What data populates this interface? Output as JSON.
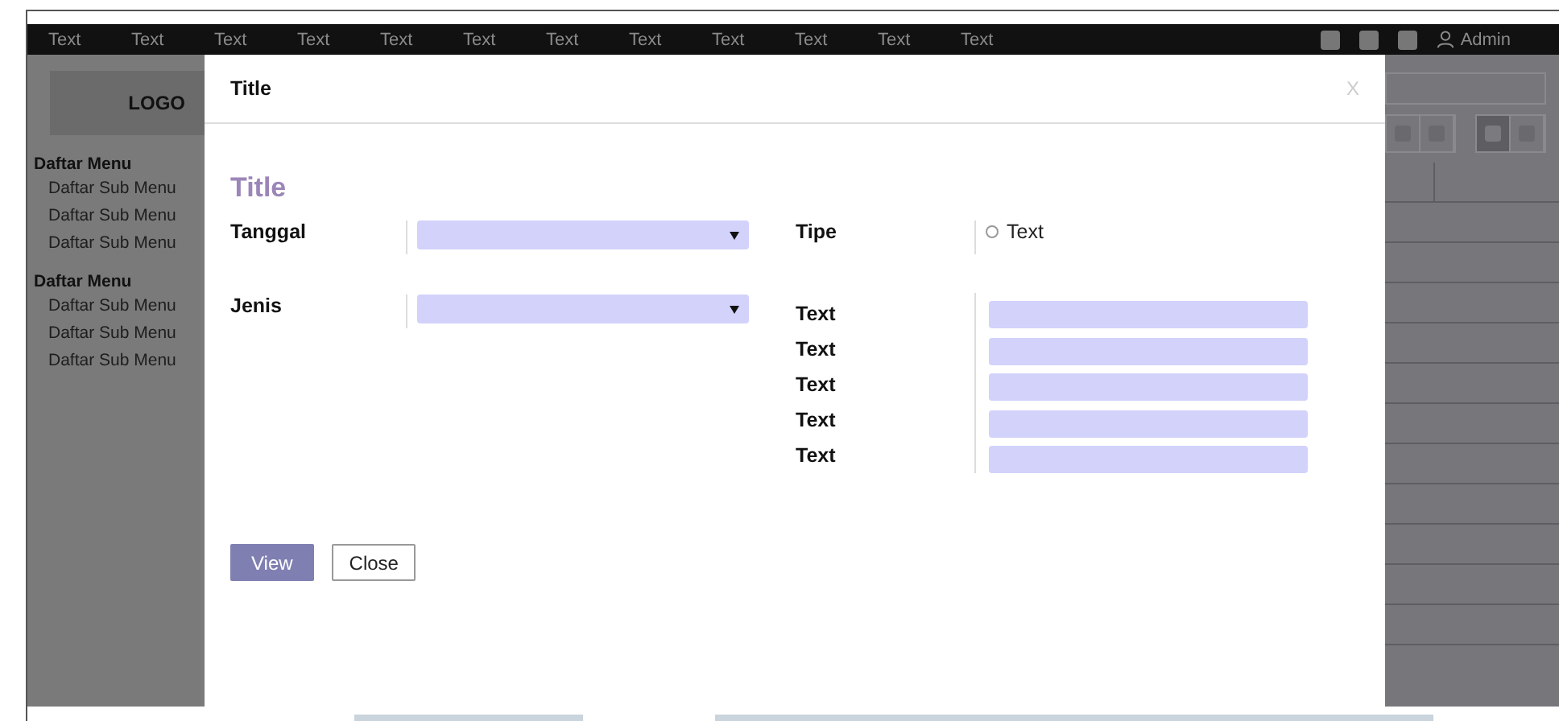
{
  "top_nav": {
    "links": [
      "Text",
      "Text",
      "Text",
      "Text",
      "Text",
      "Text",
      "Text",
      "Text",
      "Text",
      "Text",
      "Text",
      "Text"
    ],
    "user": "Admin"
  },
  "sidebar": {
    "logo": "LOGO",
    "groups": [
      {
        "title": "Daftar Menu",
        "items": [
          "Daftar Sub Menu",
          "Daftar Sub Menu",
          "Daftar Sub Menu"
        ]
      },
      {
        "title": "Daftar Menu",
        "items": [
          "Daftar Sub Menu",
          "Daftar Sub Menu",
          "Daftar Sub Menu"
        ]
      }
    ]
  },
  "modal": {
    "title": "Title",
    "close": "X",
    "section_title": "Title",
    "left_fields": [
      {
        "label": "Tanggal",
        "kind": "select"
      },
      {
        "label": "Jenis",
        "kind": "select"
      }
    ],
    "tipe": {
      "label": "Tipe",
      "options": [
        {
          "label": "Text",
          "selected": false
        }
      ]
    },
    "text_fields": [
      {
        "label": "Text"
      },
      {
        "label": "Text"
      },
      {
        "label": "Text"
      },
      {
        "label": "Text"
      },
      {
        "label": "Text"
      }
    ],
    "buttons": [
      {
        "label": "View",
        "kind": "primary"
      },
      {
        "label": "Close",
        "kind": "secondary"
      }
    ]
  }
}
